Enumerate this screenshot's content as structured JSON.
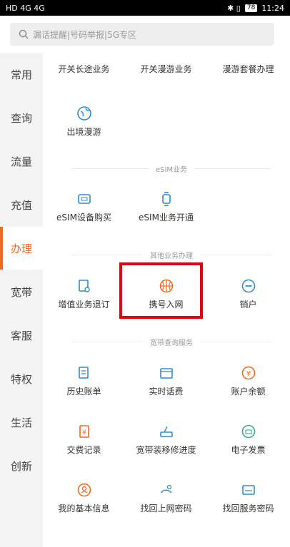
{
  "statusbar": {
    "left": "HD 4G 4G",
    "right_icons": "✱ ▯",
    "battery": "78",
    "time": "11:24"
  },
  "search": {
    "placeholder": "漏话提醒|号码举报|5G专区"
  },
  "sidebar": {
    "items": [
      {
        "label": "常用"
      },
      {
        "label": "查询"
      },
      {
        "label": "流量"
      },
      {
        "label": "充值"
      },
      {
        "label": "办理",
        "active": true
      },
      {
        "label": "宽带"
      },
      {
        "label": "客服"
      },
      {
        "label": "特权"
      },
      {
        "label": "生活"
      },
      {
        "label": "创新"
      }
    ]
  },
  "main": {
    "top_row": [
      "开关长途业务",
      "开关漫游业务",
      "漫游套餐办理"
    ],
    "roaming": [
      "出境漫游"
    ],
    "esim_title": "eSIM业务",
    "esim": [
      "eSIM设备购买",
      "eSIM业务开通"
    ],
    "other_title": "其他业务办理",
    "other": [
      "增值业务退订",
      "携号入网",
      "销户"
    ],
    "broadband_title": "宽带查询服务",
    "broadband_row1": [
      "历史账单",
      "实时话费",
      "账户余额"
    ],
    "broadband_row2": [
      "交费记录",
      "宽带装移修进度",
      "电子发票"
    ],
    "broadband_row3": [
      "我的基本信息",
      "找回上网密码",
      "找回服务密码"
    ]
  },
  "icons": {
    "accent": "#f26b1d",
    "blue": "#2f8ccf",
    "teal": "#3aa89a"
  }
}
